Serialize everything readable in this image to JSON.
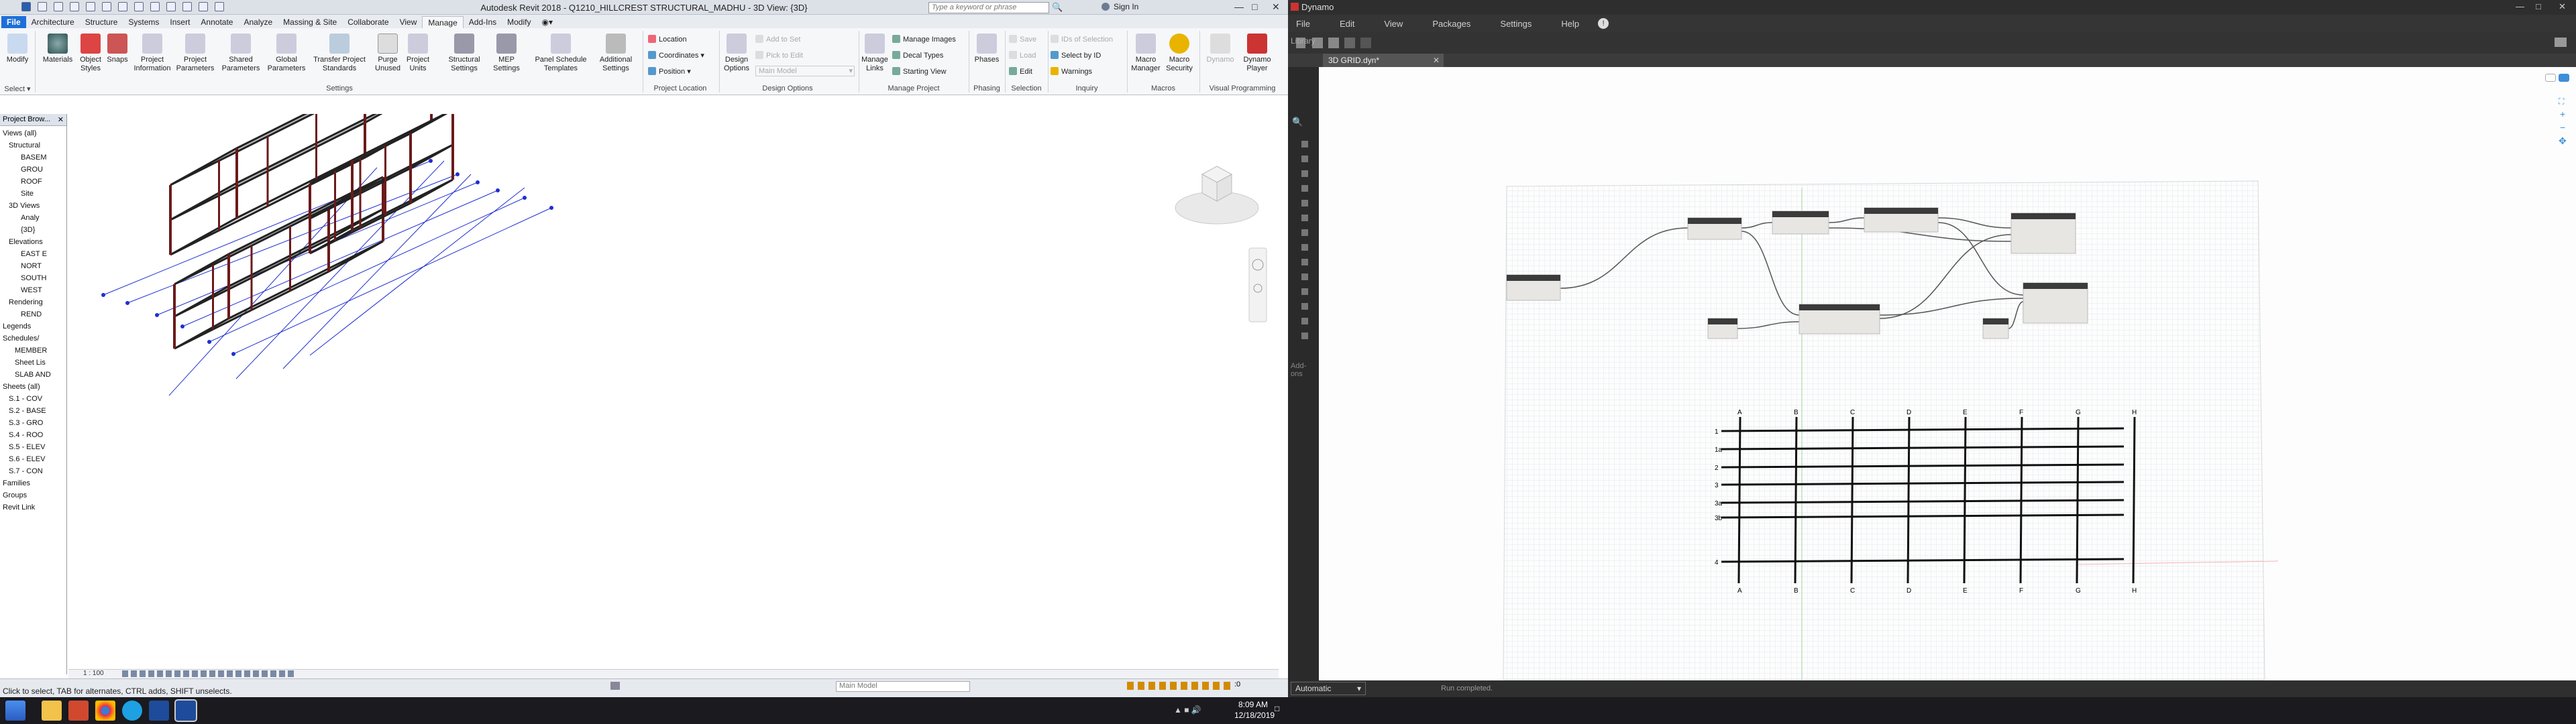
{
  "revit": {
    "window_title": "Autodesk Revit 2018 -   Q1210_HILLCREST STRUCTURAL_MADHU - 3D View: {3D}",
    "search_placeholder": "Type a keyword or phrase",
    "sign_in": "Sign In",
    "tabs": [
      "File",
      "Architecture",
      "Structure",
      "Systems",
      "Insert",
      "Annotate",
      "Analyze",
      "Massing & Site",
      "Collaborate",
      "View",
      "Manage",
      "Add-Ins",
      "Modify"
    ],
    "active_tab": "Manage",
    "ribbon": {
      "modify": "Modify",
      "select_label": "Select ▾",
      "settings_buttons": [
        "Materials",
        "Object Styles",
        "Snaps",
        "Project Information",
        "Project Parameters",
        "Shared Parameters",
        "Global Parameters",
        "Transfer Project Standards",
        "Purge Unused",
        "Project Units",
        "Structural Settings",
        "MEP Settings",
        "Panel Schedule Templates",
        "Additional Settings"
      ],
      "settings_panel": "Settings",
      "project_location": {
        "items": [
          "Location",
          "Coordinates ▾",
          "Position ▾"
        ],
        "panel": "Project Location"
      },
      "design_options": {
        "button": "Design Options",
        "add_to_set": "Add to Set",
        "pick_to_edit": "Pick to Edit",
        "main_model": "Main Model",
        "panel": "Design Options"
      },
      "manage_project": {
        "button": "Manage Links",
        "items": [
          "Manage Images",
          "Decal Types",
          "Starting View"
        ],
        "panel": "Manage Project"
      },
      "phasing": {
        "button": "Phases",
        "panel": "Phasing"
      },
      "selection": {
        "items": [
          "Save",
          "Load",
          "Edit"
        ],
        "panel": "Selection"
      },
      "inquiry": {
        "items": [
          "IDs of Selection",
          "Select by ID",
          "Warnings"
        ],
        "panel": "Inquiry"
      },
      "macros": {
        "buttons": [
          "Macro Manager",
          "Macro Security"
        ],
        "panel": "Macros"
      },
      "visual_programming": {
        "buttons": [
          "Dynamo",
          "Dynamo Player"
        ],
        "panel": "Visual Programming"
      }
    },
    "project_browser": {
      "title": "Project Brow...",
      "items": [
        {
          "text": "Views (all)",
          "indent": 0
        },
        {
          "text": "Structural",
          "indent": 1
        },
        {
          "text": "BASEM",
          "indent": 3
        },
        {
          "text": "GROU",
          "indent": 3
        },
        {
          "text": "ROOF",
          "indent": 3
        },
        {
          "text": "Site",
          "indent": 3
        },
        {
          "text": "3D Views",
          "indent": 1
        },
        {
          "text": "Analy",
          "indent": 3
        },
        {
          "text": "{3D}",
          "indent": 3
        },
        {
          "text": "Elevations",
          "indent": 1
        },
        {
          "text": "EAST E",
          "indent": 3
        },
        {
          "text": "NORT",
          "indent": 3
        },
        {
          "text": "SOUTH",
          "indent": 3
        },
        {
          "text": "WEST",
          "indent": 3
        },
        {
          "text": "Rendering",
          "indent": 1
        },
        {
          "text": "REND",
          "indent": 3
        },
        {
          "text": "Legends",
          "indent": 0
        },
        {
          "text": "Schedules/",
          "indent": 0
        },
        {
          "text": "MEMBER",
          "indent": 2
        },
        {
          "text": "Sheet Lis",
          "indent": 2
        },
        {
          "text": "SLAB AND",
          "indent": 2
        },
        {
          "text": "Sheets (all)",
          "indent": 0
        },
        {
          "text": "S.1 - COV",
          "indent": 1
        },
        {
          "text": "S.2 - BASE",
          "indent": 1
        },
        {
          "text": "S.3 - GRO",
          "indent": 1
        },
        {
          "text": "S.4 - ROO",
          "indent": 1
        },
        {
          "text": "S.5 - ELEV",
          "indent": 1
        },
        {
          "text": "S.6 - ELEV",
          "indent": 1
        },
        {
          "text": "S.7 - CON",
          "indent": 1
        },
        {
          "text": "Families",
          "indent": 0
        },
        {
          "text": "Groups",
          "indent": 0
        },
        {
          "text": "Revit Link",
          "indent": 0
        }
      ]
    },
    "scale": "1 : 100",
    "status": "Click to select, TAB for alternates, CTRL adds, SHIFT unselects.",
    "status_model": "Main Model",
    "status_zero": ":0"
  },
  "dynamo": {
    "window_title": "Dynamo",
    "menu": [
      "File",
      "Edit",
      "View",
      "Packages",
      "Settings",
      "Help"
    ],
    "file_tab": "3D GRID.dyn*",
    "library_label": "Library",
    "addons_label": "Add-ons",
    "run_mode": "Automatic",
    "run_status": "Run completed.",
    "grid_letters": [
      "A",
      "B",
      "C",
      "D",
      "E",
      "F",
      "G",
      "H"
    ],
    "grid_numbers": [
      "1",
      "1a",
      "2",
      "3",
      "3a",
      "3b",
      "4"
    ]
  },
  "taskbar": {
    "time": "8:09 AM",
    "date": "12/18/2019"
  },
  "colors": {
    "revit_accent": "#1e6fd9",
    "dynamo_bg": "#3b3b3b",
    "grid_blue": "#1f2fd0"
  }
}
